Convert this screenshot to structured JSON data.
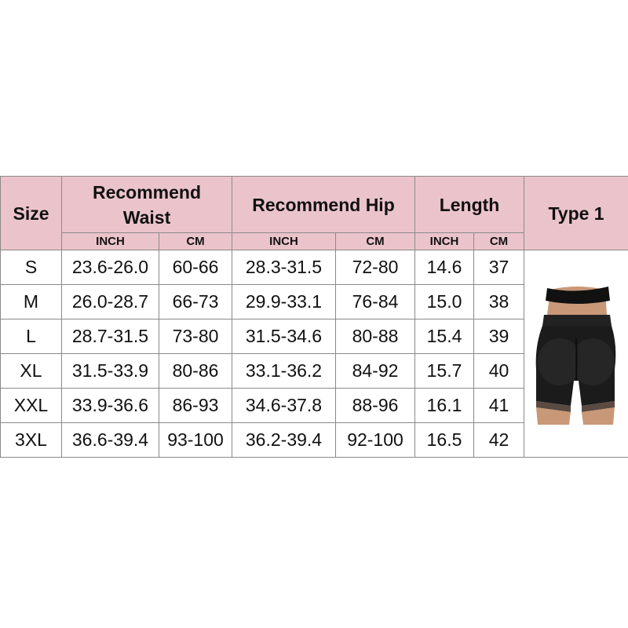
{
  "headers": {
    "size": "Size",
    "waist": "Recommend Waist",
    "hip": "Recommend Hip",
    "length": "Length",
    "type": "Type 1",
    "inch": "INCH",
    "cm": "CM"
  },
  "rows": [
    {
      "size": "S",
      "waist_in": "23.6-26.0",
      "waist_cm": "60-66",
      "hip_in": "28.3-31.5",
      "hip_cm": "72-80",
      "len_in": "14.6",
      "len_cm": "37"
    },
    {
      "size": "M",
      "waist_in": "26.0-28.7",
      "waist_cm": "66-73",
      "hip_in": "29.9-33.1",
      "hip_cm": "76-84",
      "len_in": "15.0",
      "len_cm": "38"
    },
    {
      "size": "L",
      "waist_in": "28.7-31.5",
      "waist_cm": "73-80",
      "hip_in": "31.5-34.6",
      "hip_cm": "80-88",
      "len_in": "15.4",
      "len_cm": "39"
    },
    {
      "size": "XL",
      "waist_in": "31.5-33.9",
      "waist_cm": "80-86",
      "hip_in": "33.1-36.2",
      "hip_cm": "84-92",
      "len_in": "15.7",
      "len_cm": "40"
    },
    {
      "size": "XXL",
      "waist_in": "33.9-36.6",
      "waist_cm": "86-93",
      "hip_in": "34.6-37.8",
      "hip_cm": "88-96",
      "len_in": "16.1",
      "len_cm": "41"
    },
    {
      "size": "3XL",
      "waist_in": "36.6-39.4",
      "waist_cm": "93-100",
      "hip_in": "36.2-39.4",
      "hip_cm": "92-100",
      "len_in": "16.5",
      "len_cm": "42"
    }
  ],
  "colors": {
    "header_bg": "#ebc4cb",
    "border": "#8a8a8a",
    "shorts": "#1b1b1b"
  },
  "icons": {
    "product": "shorts-product-image"
  }
}
